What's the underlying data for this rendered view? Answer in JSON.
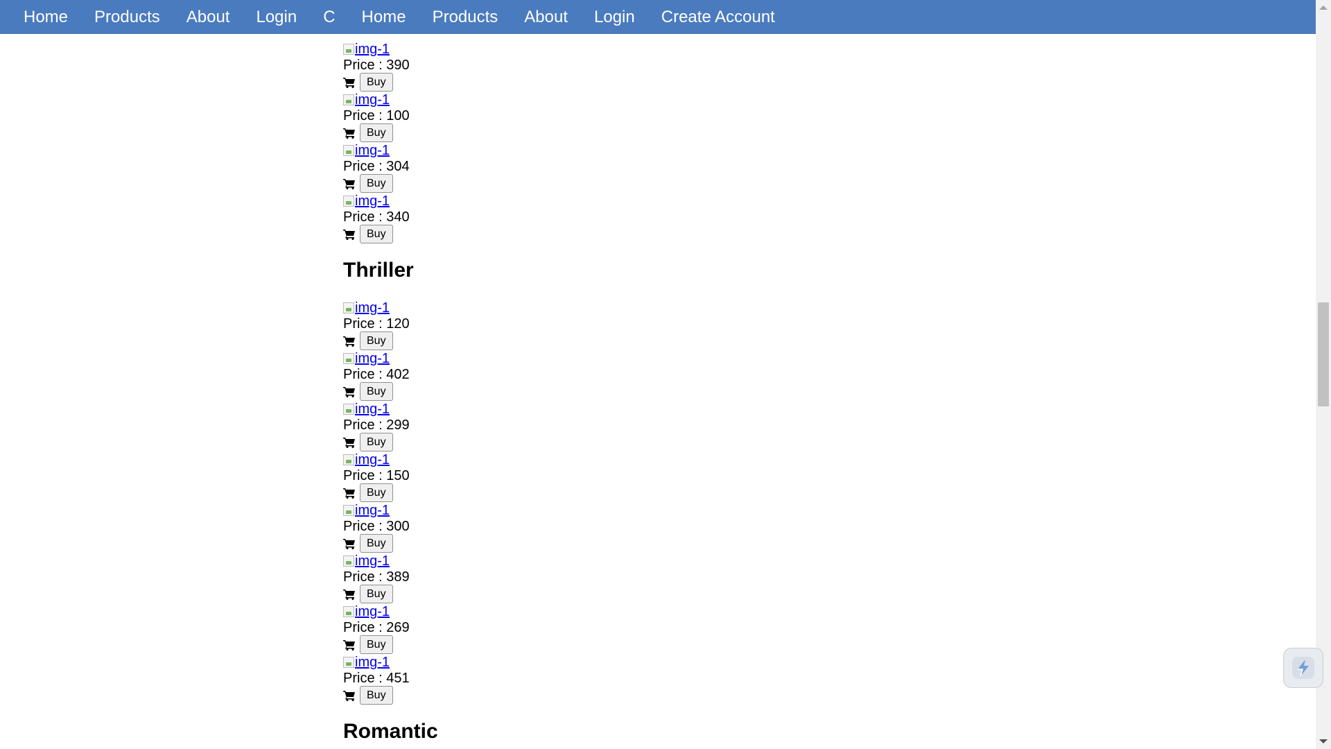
{
  "navbar": {
    "links": [
      "Home",
      "Products",
      "About",
      "Login",
      "C",
      "Home",
      "Products",
      "About",
      "Login",
      "Create Account"
    ],
    "background": "#4a7bbf"
  },
  "product_common": {
    "img_alt": "img-1",
    "buy_label": "Buy"
  },
  "sections": {
    "previous": {
      "prices": [
        "Price : 390",
        "Price : 100",
        "Price : 304",
        "Price : 340"
      ]
    },
    "thriller": {
      "title": "Thriller",
      "prices": [
        "Price : 120",
        "Price : 402",
        "Price : 299",
        "Price : 150",
        "Price : 300",
        "Price : 389",
        "Price : 269",
        "Price : 451"
      ]
    },
    "romantic": {
      "title": "Romantic"
    }
  },
  "icons": {
    "cart": "shopping-cart-icon",
    "extension": "lightning-extension-icon"
  }
}
